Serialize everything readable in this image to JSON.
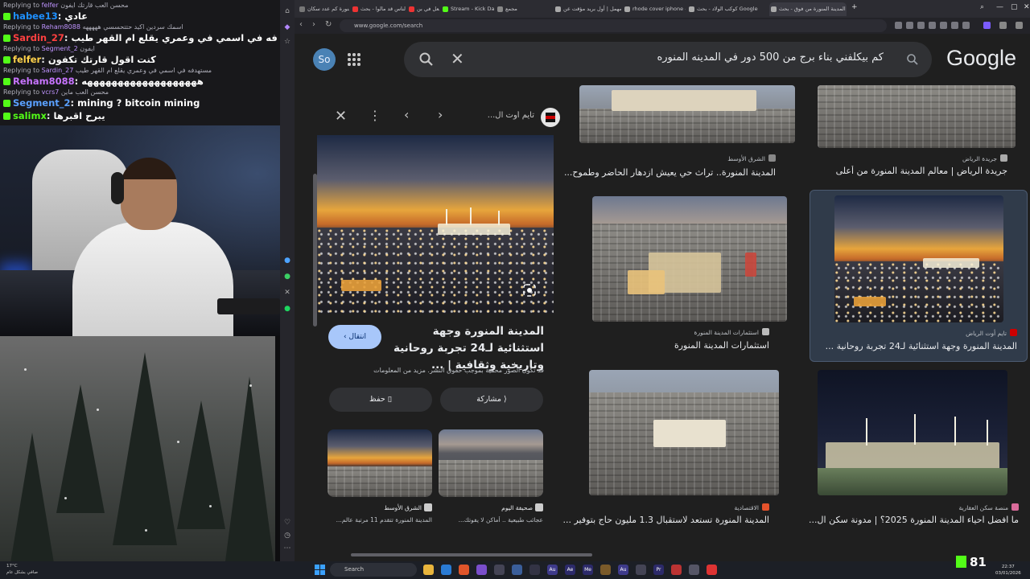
{
  "chat": {
    "lines": [
      {
        "type": "reply",
        "text": "Replying to",
        "user": "felfer",
        "rest": "محسن العب قارتك ايفون"
      },
      {
        "type": "msg",
        "user": "habee13",
        "color": "#1e90ff",
        "text": "عادي"
      },
      {
        "type": "reply",
        "text": "Replying to",
        "user": "Reham8088",
        "rest": "اسمك سردين اكيد حتتحسسي هههههه"
      },
      {
        "type": "msg",
        "user": "Sardin_27",
        "color": "#ff4040",
        "text": "مستهدفه في اسمي في وعمري يقلع ام القهر طيب"
      },
      {
        "type": "reply",
        "text": "Replying to",
        "user": "Segment_2",
        "rest": "ايفون"
      },
      {
        "type": "msg",
        "user": "felfer",
        "color": "#ffd24a",
        "text": "كنت اقول قارتك تكفون"
      },
      {
        "type": "reply",
        "text": "Replying to",
        "user": "Sardin_27",
        "rest": "مستهدفه في اسمي في وعمري يقلع ام القهر طيب"
      },
      {
        "type": "msg",
        "user": "Reham8088",
        "color": "#c774ff",
        "text": "هههههههههههههههههههه"
      },
      {
        "type": "reply",
        "text": "Replying to",
        "user": "vcrs7",
        "rest": "محسن العب ماين"
      },
      {
        "type": "msg",
        "user": "Segment_2",
        "color": "#5aa0ff",
        "text": "mining ? bitcoin mining"
      },
      {
        "type": "msg",
        "user": "salimx",
        "color": "#53fc18",
        "text": "يبرح اقبرها"
      }
    ]
  },
  "browser": {
    "tabs": [
      {
        "label": "المدينة المنورة كم عدد سكان...",
        "fav": "#777"
      },
      {
        "label": "رأيت الناس قد مالوا - بحث",
        "fav": "#e33"
      },
      {
        "label": "السعودية تبدأ بالفعل في بن",
        "fav": "#e33"
      },
      {
        "label": "Stream - Kick Dashboard",
        "fav": "#53fc18"
      },
      {
        "label": "مجمع",
        "fav": "#888"
      },
      {
        "label": "مهمل | أول بريد مؤقت عن",
        "fav": "#aaa"
      },
      {
        "label": "rhode cover iphone - بحث",
        "fav": "#aaa"
      },
      {
        "label": "كوكب الولاد - بحث Google",
        "fav": "#aaa"
      },
      {
        "label": "المدينة المنورة من فوق - بحث",
        "fav": "#aaa"
      }
    ],
    "url": "www.google.com/search"
  },
  "google": {
    "avatar": "So",
    "query": "كم بيكلفني بناء برج من 500 دور في المدينه المنوره",
    "logo": "Google"
  },
  "preview": {
    "source": "تايم أوت ال...",
    "title": "المدينة المنورة وجهة استثنائية لـ24 تجربة روحانية وتاريخية وثقافية | ...",
    "visit": "انتقال",
    "rights": "قد تكون الصور محمية بموجب حقوق النشر. مزيد من المعلومات",
    "save": "حفظ",
    "share": "مشاركة",
    "related": [
      {
        "source": "الشرق الأوسط",
        "caption": "المدينة المنورة تتقدم 11 مرتبة عالم..."
      },
      {
        "source": "صحيفة اليوم",
        "caption": "عجائب طبيعية .. أماكن لا يفوتك..."
      }
    ]
  },
  "results": [
    {
      "source": "الشرق الأوسط",
      "caption": "المدينة المنورة.. تراث حي يعيش ازدهار الحاضر وطموح...",
      "icon": "#888"
    },
    {
      "source": "جريدة الرياض",
      "caption": "جريدة الرياض | معالم المدينة المنورة من أعلى",
      "icon": "#aaa"
    },
    {
      "source": "استثمارات المدينة المنورة",
      "caption": "استثمارات المدينة المنورة",
      "icon": "#bbb"
    },
    {
      "source": "تايم أوت الرياض",
      "caption": "المدينة المنورة وجهة استثنائية لـ24 تجربة روحانية ...",
      "icon": "#c00"
    },
    {
      "source": "الاقتصادية",
      "caption": "المدينة المنورة تستعد لاستقبال 1.3 مليون حاج بتوفير ...",
      "icon": "#e5522b"
    },
    {
      "source": "منصة سكن العقارية",
      "caption": "ما افضل احياء المدينة المنورة 2025؟ | مدونة سكن ال...",
      "icon": "#d96b9a"
    }
  ],
  "taskbar": {
    "weather_temp": "17°C",
    "weather_desc": "صافي بشكل عام",
    "search": "Search",
    "viewers": "81",
    "time": "22:37",
    "date": "03/01/2026"
  }
}
